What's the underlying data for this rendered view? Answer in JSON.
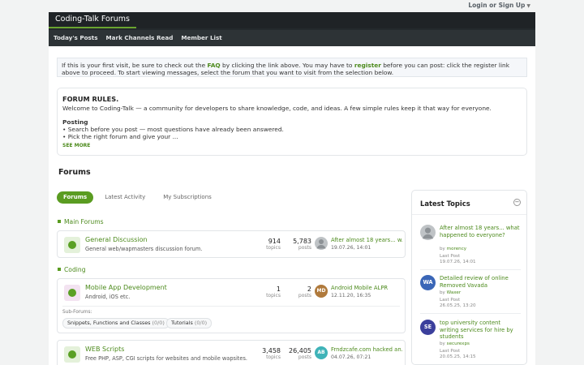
{
  "topbar": {
    "login": "Login or Sign Up"
  },
  "header": {
    "site_title": "Coding-Talk Forums"
  },
  "subnav": [
    "Today's Posts",
    "Mark Channels Read",
    "Member List"
  ],
  "notice": {
    "pre": "If this is your first visit, be sure to check out the ",
    "faq": "FAQ",
    "mid": " by clicking the link above. You may have to ",
    "register": "register",
    "post": " before you can post: click the register link above to proceed. To start viewing messages, select the forum that you want to visit from the selection below."
  },
  "rules": {
    "title": "FORUM RULES.",
    "intro": "Welcome to Coding-Talk — a community for developers to share knowledge, code, and ideas. A few simple rules keep it that way for everyone.",
    "heading": "Posting",
    "line1": "• Search before you post — most questions have already been answered.",
    "line2": "• Pick the right forum and give your ...",
    "see_more": "SEE MORE"
  },
  "forums_title": "Forums",
  "tabs": [
    "Forums",
    "Latest Activity",
    "My Subscriptions"
  ],
  "categories": [
    "Main Forums",
    "Coding"
  ],
  "forums": [
    {
      "name": "General Discussion",
      "desc": "General web/wapmasters discussion forum.",
      "topics": "914",
      "posts": "5,783",
      "topics_label": "topics",
      "posts_label": "posts",
      "last_title": "After almost 18 years... w...",
      "last_date": "19.07.26, 14:01",
      "avatar": "",
      "avatar_color": "#bfc3c6"
    },
    {
      "name": "Mobile App Development",
      "desc": "Android, iOS etc.",
      "topics": "1",
      "posts": "2",
      "topics_label": "topics",
      "posts_label": "posts",
      "last_title": "Android Mobile ALPR",
      "last_date": "12.11.20, 16:35",
      "avatar": "MD",
      "avatar_color": "#b07a3c",
      "sub_label": "Sub-Forums:",
      "subs": [
        {
          "name": "Snippets, Functions and Classes",
          "count": "(0/0)"
        },
        {
          "name": "Tutorials",
          "count": "(0/0)"
        }
      ]
    },
    {
      "name": "WEB Scripts",
      "desc": "Free PHP, ASP, CGI scripts for websites and mobile wapsites.",
      "topics": "3,458",
      "posts": "26,405",
      "topics_label": "topics",
      "posts_label": "posts",
      "last_title": "Frndzcafe.com hacked an...",
      "last_date": "04.07.26, 07:21",
      "avatar": "AB",
      "avatar_color": "#3fb3b8"
    }
  ],
  "sidebar": {
    "title": "Latest Topics",
    "toggle": "−",
    "items": [
      {
        "title": "After almost 18 years... what happened to everyone?",
        "by": "by",
        "author": "morency",
        "last_label": "Last Post",
        "date": "19.07.26, 14:01",
        "avatar": "",
        "color": "#bfc3c6"
      },
      {
        "title": "Detailed review of online Removed Vavada",
        "by": "by",
        "author": "Waxer",
        "last_label": "Last Post",
        "date": "26.05.25, 13:20",
        "avatar": "WA",
        "color": "#3a66b7"
      },
      {
        "title": "top university content writing services for hire by students",
        "by": "by",
        "author": "securexps",
        "last_label": "Last Post",
        "date": "20.05.25, 14:15",
        "avatar": "SE",
        "color": "#3b3f9c"
      }
    ]
  }
}
